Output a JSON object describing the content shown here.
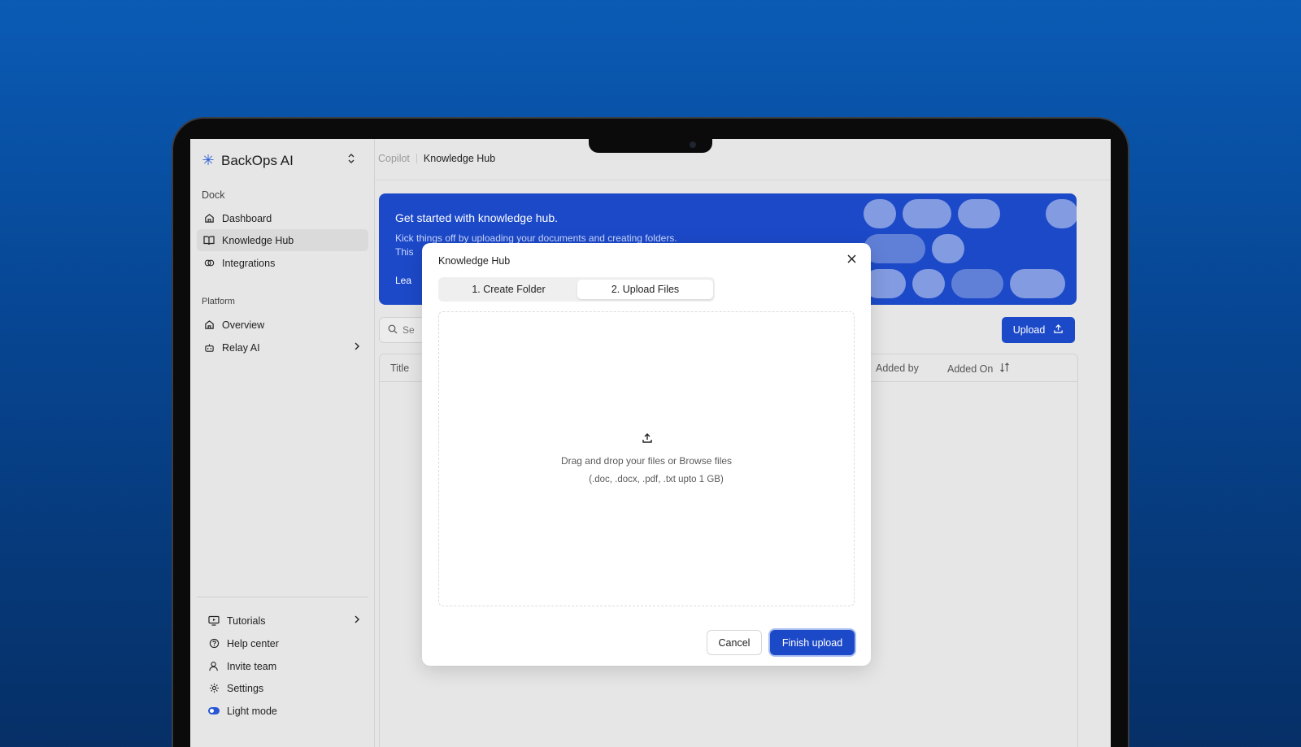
{
  "sidebar": {
    "brand": "BackOps AI",
    "sections": {
      "dock_label": "Dock",
      "platform_label": "Platform"
    },
    "dock_items": [
      {
        "label": "Dashboard",
        "icon": "home-icon"
      },
      {
        "label": "Knowledge Hub",
        "icon": "book-icon",
        "active": true
      },
      {
        "label": "Integrations",
        "icon": "link-icon"
      }
    ],
    "platform_items": [
      {
        "label": "Overview",
        "icon": "home-icon"
      },
      {
        "label": "Relay AI",
        "icon": "robot-icon"
      }
    ],
    "bottom_items": [
      {
        "label": "Tutorials",
        "icon": "monitor-play-icon"
      },
      {
        "label": "Help center",
        "icon": "help-circle-icon"
      },
      {
        "label": "Invite team",
        "icon": "user-icon"
      },
      {
        "label": "Settings",
        "icon": "gear-icon"
      },
      {
        "label": "Light mode",
        "icon": "toggle-icon"
      }
    ]
  },
  "header": {
    "breadcrumb": [
      "Copilot",
      "Knowledge Hub"
    ]
  },
  "banner": {
    "title": "Get started with knowledge hub.",
    "subtitle_line1": "Kick things off by uploading your documents and creating folders.",
    "subtitle_line2": "This",
    "link": "Lea"
  },
  "toolbar": {
    "search_placeholder": "Se",
    "upload_label": "Upload"
  },
  "table": {
    "columns": [
      "Title",
      "Added by",
      "Added On"
    ]
  },
  "modal": {
    "title": "Knowledge Hub",
    "tabs": [
      "1. Create Folder",
      "2. Upload Files"
    ],
    "active_tab": 1,
    "dropzone_text": "Drag and drop your files or Browse files",
    "dropzone_hint": "(.doc, .docx, .pdf, .txt upto 1 GB)",
    "cancel_label": "Cancel",
    "finish_label": "Finish upload"
  },
  "colors": {
    "accent": "#1c49c8",
    "background_top": "#0a5bb5",
    "background_bottom": "#062f66"
  }
}
